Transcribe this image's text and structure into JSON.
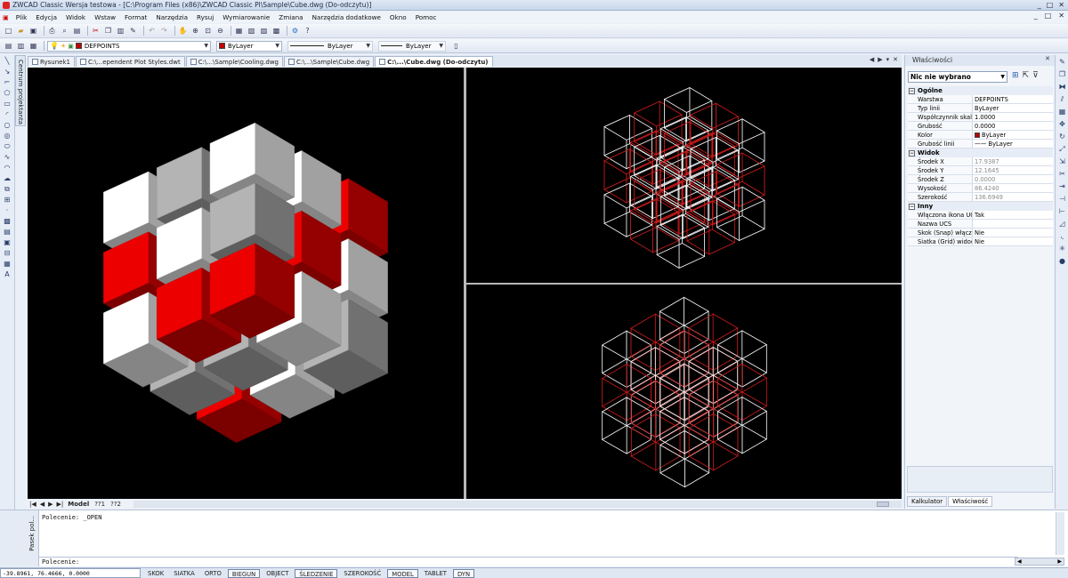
{
  "window": {
    "title": "ZWCAD Classic Wersja testowa - [C:\\Program Files (x86)\\ZWCAD Classic Pl\\Sample\\Cube.dwg (Do-odczytu)]",
    "controls": [
      "_",
      "□",
      "✕"
    ],
    "doc_controls": [
      "_",
      "□",
      "✕"
    ]
  },
  "menu": {
    "items": [
      "Plik",
      "Edycja",
      "Widok",
      "Wstaw",
      "Format",
      "Narzędzia",
      "Rysuj",
      "Wymiarowanie",
      "Zmiana",
      "Narzędzia dodatkowe",
      "Okno",
      "Pomoc"
    ]
  },
  "layers_toolbar": {
    "layer_value": "DEFPOINTS",
    "color_value": "ByLayer",
    "linetype_value": "ByLayer",
    "lineweight_value": "ByLayer"
  },
  "doc_tabs": [
    {
      "label": "Rysunek1",
      "active": false
    },
    {
      "label": "C:\\...ependent Plot Styles.dwt",
      "active": false
    },
    {
      "label": "C:\\...\\Sample\\Cooling.dwg",
      "active": false
    },
    {
      "label": "C:\\...\\Sample\\Cube.dwg",
      "active": false
    },
    {
      "label": "C:\\...\\Cube.dwg (Do-odczytu)",
      "active": true
    }
  ],
  "tool_palette_label": "Centrum projektanta",
  "layout_tabs": {
    "nav": [
      "|◀",
      "◀",
      "▶",
      "▶|"
    ],
    "tabs": [
      {
        "label": "Model",
        "active": true
      },
      {
        "label": "??1",
        "active": false
      },
      {
        "label": "??2",
        "active": false
      }
    ]
  },
  "properties": {
    "title": "Właściwości",
    "selection": "Nic nie wybrano",
    "categories": [
      {
        "name": "Ogólne",
        "rows": [
          {
            "key": "Warstwa",
            "value": "DEFPOINTS",
            "dim": false
          },
          {
            "key": "Typ linii",
            "value": "ByLayer",
            "dim": false
          },
          {
            "key": "Współczynnik skali",
            "value": "1.0000",
            "dim": false
          },
          {
            "key": "Grubość",
            "value": "0.0000",
            "dim": false
          },
          {
            "key": "Kolor",
            "value": "ByLayer",
            "dim": false,
            "swatch": "#c00000"
          },
          {
            "key": "Grubość linii",
            "value": "—— ByLayer",
            "dim": false
          }
        ]
      },
      {
        "name": "Widok",
        "rows": [
          {
            "key": "Środek X",
            "value": "17.9387",
            "dim": true
          },
          {
            "key": "Środek Y",
            "value": "12.1645",
            "dim": true
          },
          {
            "key": "Środek Z",
            "value": "0.0000",
            "dim": true
          },
          {
            "key": "Wysokość",
            "value": "86.4240",
            "dim": true
          },
          {
            "key": "Szerokość",
            "value": "136.6949",
            "dim": true
          }
        ]
      },
      {
        "name": "Inny",
        "rows": [
          {
            "key": "Włączona ikona UCS",
            "value": "Tak",
            "dim": false
          },
          {
            "key": "Nazwa UCS",
            "value": "",
            "dim": false
          },
          {
            "key": "Skok (Snap) włączony",
            "value": "Nie",
            "dim": false
          },
          {
            "key": "Siatka (Grid) widoczna",
            "value": "Nie",
            "dim": false
          }
        ]
      }
    ],
    "bottom_tabs": [
      {
        "label": "Kalkulator",
        "active": false
      },
      {
        "label": "Właściwość",
        "active": true
      }
    ]
  },
  "command": {
    "side_label": "Pasek pol...",
    "history": "Polecenie: _OPEN",
    "prompt": "Polecenie:"
  },
  "status": {
    "coords": "-39.8961, 76.4666, 0.0000",
    "buttons": [
      {
        "label": "SKOK",
        "on": false
      },
      {
        "label": "SIATKA",
        "on": false
      },
      {
        "label": "ORTO",
        "on": false
      },
      {
        "label": "BIEGUN",
        "on": true
      },
      {
        "label": "OBJECT",
        "on": false
      },
      {
        "label": "ŚLEDZENIE",
        "on": true
      },
      {
        "label": "SZEROKOŚĆ",
        "on": false
      },
      {
        "label": "MODEL",
        "on": true
      },
      {
        "label": "TABLET",
        "on": false
      },
      {
        "label": "DYN",
        "on": true
      }
    ]
  },
  "colors": {
    "cube_red": "#e00000",
    "cube_white": "#f2f2f2",
    "cube_grey": "#aaaaaa",
    "wire_red": "#c81c1c",
    "wire_white": "#f0f0f0",
    "viewport_bg": "#000000"
  }
}
